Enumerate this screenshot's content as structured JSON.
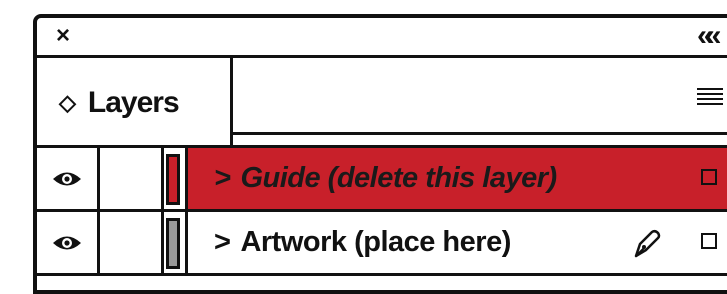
{
  "panel": {
    "close_label": "×",
    "collapse_label": "«",
    "tab_arrows": "◇",
    "tab_title": "Layers"
  },
  "layers": [
    {
      "name": "Guide (delete this layer)",
      "chevron": ">",
      "visible": true,
      "color": "#c8202a",
      "selected": true,
      "editing": false
    },
    {
      "name": "Artwork (place here)",
      "chevron": ">",
      "visible": true,
      "color": "#9a9a9a",
      "selected": false,
      "editing": true
    }
  ],
  "colors": {
    "selection": "#c8202a",
    "ink": "#111111"
  },
  "icons": [
    "close-icon",
    "collapse-panel-icon",
    "sort-arrows-icon",
    "panel-menu-icon",
    "eye-icon",
    "chevron-right-icon",
    "pen-icon",
    "target-icon"
  ]
}
